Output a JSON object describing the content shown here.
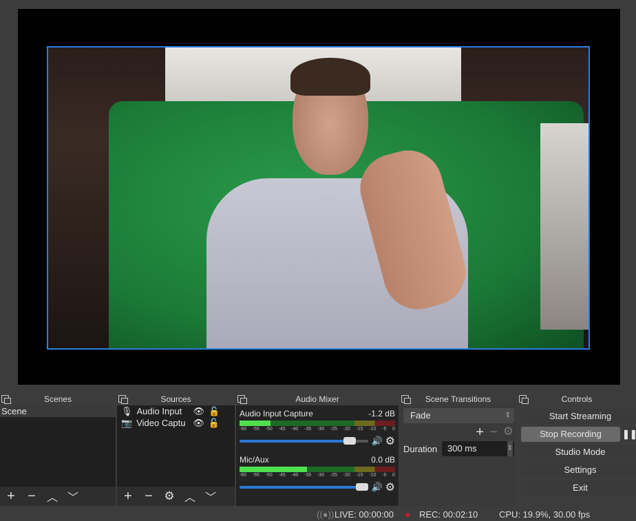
{
  "docks": {
    "scenes": "Scenes",
    "sources": "Sources",
    "mixer": "Audio Mixer",
    "transitions": "Scene Transitions",
    "controls": "Controls"
  },
  "scenes": {
    "items": [
      "Scene"
    ]
  },
  "sources": {
    "items": [
      {
        "name": "Audio Input",
        "icon": "microphone-icon",
        "visible": true,
        "locked": false
      },
      {
        "name": "Video Captu",
        "icon": "camera-icon",
        "visible": true,
        "locked": false
      }
    ]
  },
  "mixer": {
    "scale": [
      "-60",
      "-55",
      "-50",
      "-45",
      "-40",
      "-35",
      "-30",
      "-25",
      "-20",
      "-15",
      "-10",
      "-5",
      "0"
    ],
    "channels": [
      {
        "name": "Audio Input Capture",
        "db": "-1.2 dB",
        "level_db": -48,
        "volume_pct": 90
      },
      {
        "name": "Mic/Aux",
        "db": "0.0 dB",
        "level_db": -34,
        "volume_pct": 100
      }
    ]
  },
  "transitions": {
    "selected": "Fade",
    "duration_label": "Duration",
    "duration": "300 ms"
  },
  "controls": {
    "start_streaming": "Start Streaming",
    "stop_recording": "Stop Recording",
    "studio_mode": "Studio Mode",
    "settings": "Settings",
    "exit": "Exit"
  },
  "status": {
    "live": "LIVE: 00:00:00",
    "rec": "REC: 00:02:10",
    "cpu": "CPU: 19.9%, 30.00 fps"
  },
  "colors": {
    "selection": "#2a7fe0",
    "rec_dot": "#e0141e",
    "meter_green": "#4fe04f",
    "volume_fill": "#2c7ad6"
  }
}
